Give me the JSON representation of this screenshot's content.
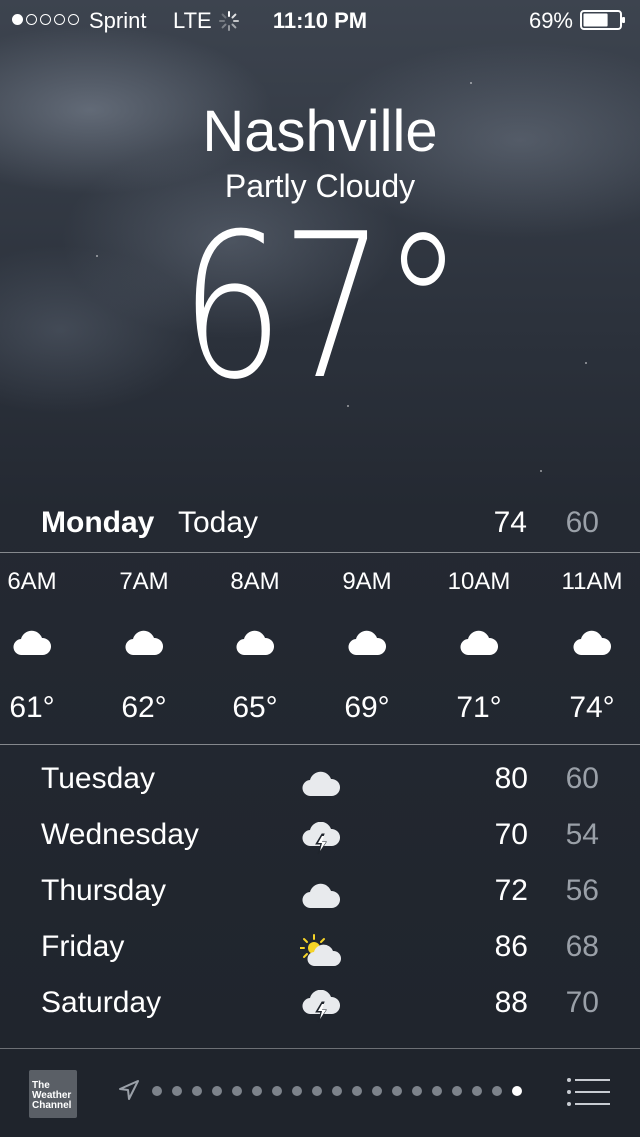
{
  "status_bar": {
    "signal_dots": [
      true,
      false,
      false,
      false,
      false
    ],
    "carrier": "Sprint",
    "network": "LTE",
    "time": "11:10 PM",
    "battery_percent": "69%",
    "battery_level": 0.69
  },
  "header": {
    "city": "Nashville",
    "condition": "Partly Cloudy",
    "temperature": "67°"
  },
  "today": {
    "day": "Monday",
    "label": "Today",
    "high": "74",
    "low": "60"
  },
  "hourly": [
    {
      "time": "6AM",
      "icon": "cloud-icon",
      "temp": "61°"
    },
    {
      "time": "7AM",
      "icon": "cloud-icon",
      "temp": "62°"
    },
    {
      "time": "8AM",
      "icon": "cloud-icon",
      "temp": "65°"
    },
    {
      "time": "9AM",
      "icon": "cloud-icon",
      "temp": "69°"
    },
    {
      "time": "10AM",
      "icon": "cloud-icon",
      "temp": "71°"
    },
    {
      "time": "11AM",
      "icon": "cloud-icon",
      "temp": "74°"
    }
  ],
  "daily": [
    {
      "day": "Tuesday",
      "icon": "cloud-icon",
      "high": "80",
      "low": "60"
    },
    {
      "day": "Wednesday",
      "icon": "thunderstorm-icon",
      "high": "70",
      "low": "54"
    },
    {
      "day": "Thursday",
      "icon": "cloud-icon",
      "high": "72",
      "low": "56"
    },
    {
      "day": "Friday",
      "icon": "partly-sunny-icon",
      "high": "86",
      "low": "68"
    },
    {
      "day": "Saturday",
      "icon": "thunderstorm-icon",
      "high": "88",
      "low": "70"
    }
  ],
  "toolbar": {
    "logo_text": "The Weather Channel",
    "page_count": 19,
    "active_page": 19,
    "location_icon": "location-arrow-icon",
    "list_icon": "list-icon"
  }
}
